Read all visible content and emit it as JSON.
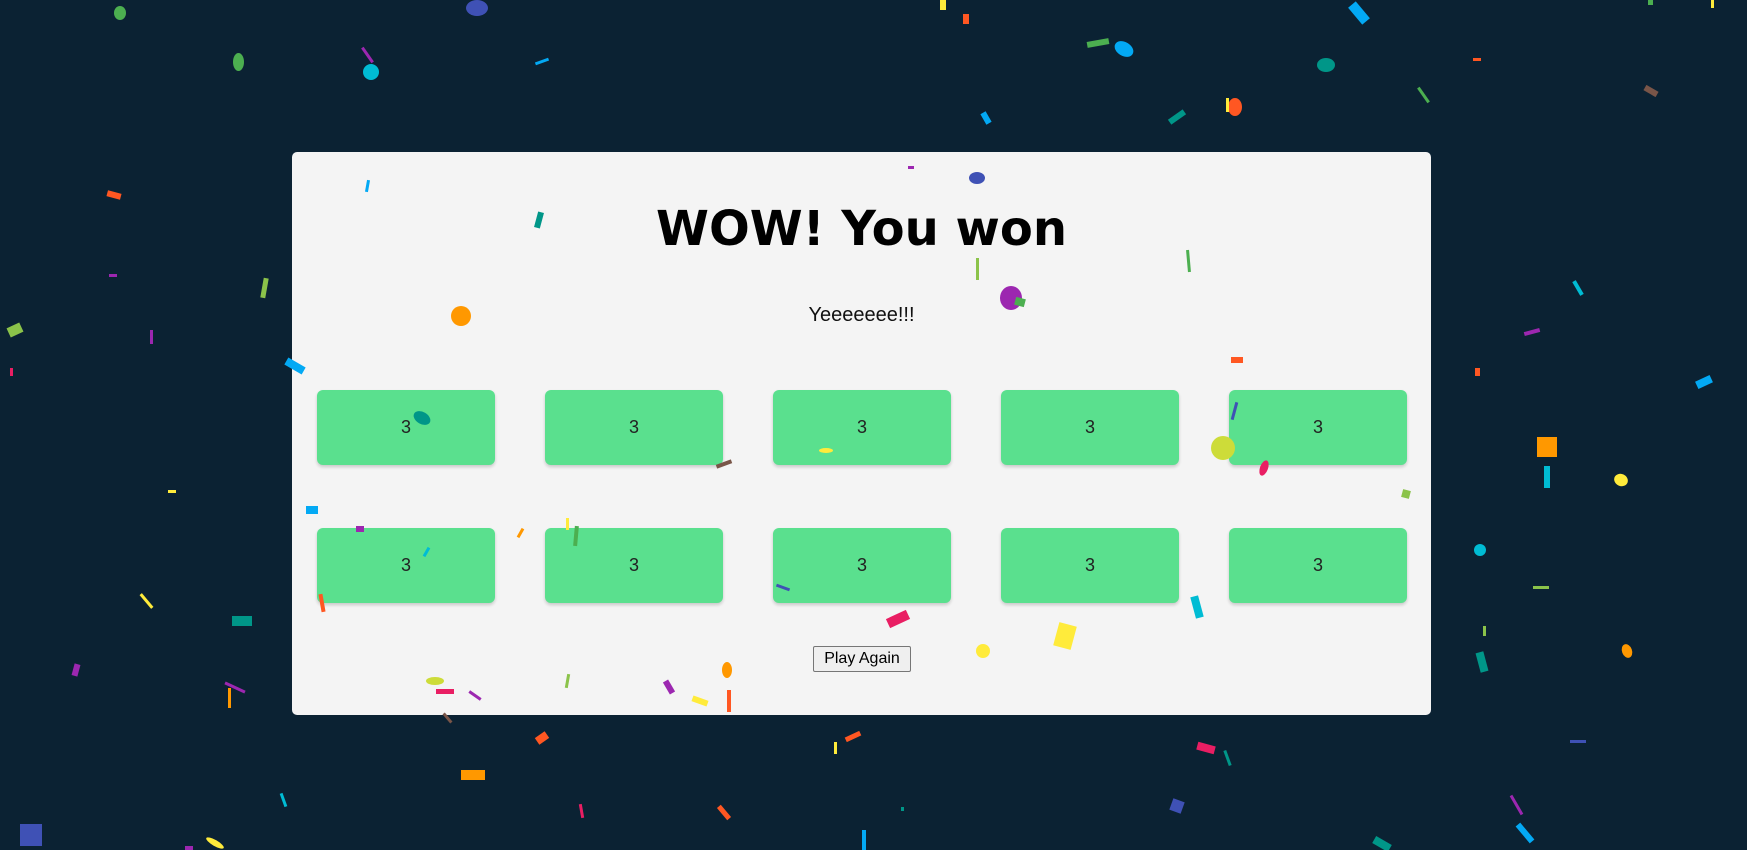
{
  "game": {
    "title": "WOW! You won",
    "subtitle": "Yeeeeeee!!!",
    "play_again_label": "Play Again",
    "tiles": [
      [
        "3",
        "3",
        "3",
        "3",
        "3"
      ],
      [
        "3",
        "3",
        "3",
        "3",
        "3"
      ]
    ]
  },
  "colors": {
    "background": "#0b2233",
    "panel": "#f4f4f4",
    "tile": "#5ae08e",
    "confetti": [
      "#4caf50",
      "#3f51b5",
      "#ff9800",
      "#00bcd4",
      "#e91e63",
      "#9c27b0",
      "#ffeb3b",
      "#03a9f4",
      "#ff5722",
      "#009688",
      "#8bc34a",
      "#cddc39",
      "#795548"
    ]
  }
}
